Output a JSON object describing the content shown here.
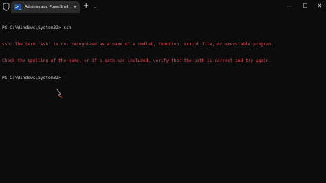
{
  "window": {
    "tab_title": "Administrator: PowerShell",
    "tab_icon_glyph": ">_",
    "tab_close": "✕",
    "new_tab": "+",
    "dropdown": "⌄",
    "minimize": "—",
    "maximize": "☐",
    "close": "✕"
  },
  "console": {
    "lines": [
      {
        "text": "PS C:\\Windows\\System32> ssh",
        "color": "#cccccc"
      },
      {
        "text": "ssh: The term 'ssh' is not recognized as a name of a cmdlet, function, script file, or executable program.",
        "color": "#e74856"
      },
      {
        "text": "Check the spelling of the name, or if a path was included, verify that the path is correct and try again.",
        "color": "#e74856"
      },
      {
        "text": "PS C:\\Windows\\System32> ",
        "color": "#cccccc"
      }
    ]
  },
  "colors": {
    "background": "#0c0c0c",
    "tab_bg": "#2b2b2b",
    "error": "#e74856",
    "text": "#cccccc"
  }
}
